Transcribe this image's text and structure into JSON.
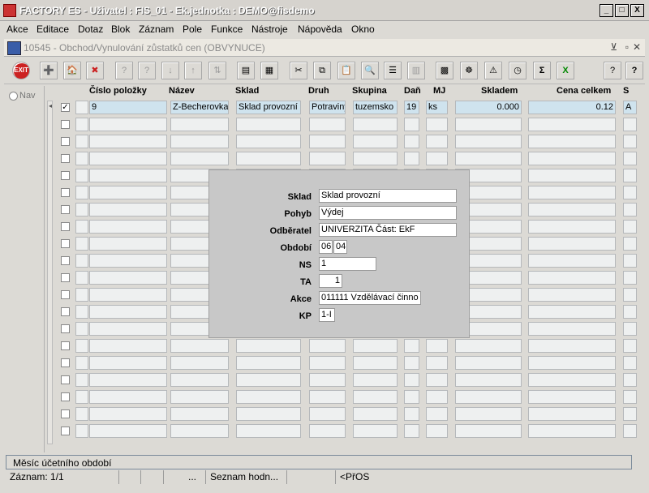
{
  "window": {
    "title": "FACTORY ES - Uživatel : FIS_01 - Ek.jednotka : DEMO@fisdemo",
    "btn_min": "_",
    "btn_max": "□",
    "btn_close": "X"
  },
  "menu": [
    "Akce",
    "Editace",
    "Dotaz",
    "Blok",
    "Záznam",
    "Pole",
    "Funkce",
    "Nástroje",
    "Nápověda",
    "Okno"
  ],
  "form": {
    "title": "10545 - Obchod/Vynulování zůstatků cen (OBVYNUCE)"
  },
  "toolbar": {
    "exit": "EXIT",
    "sum": "Σ"
  },
  "nav": {
    "label": "Nav"
  },
  "grid": {
    "headers": {
      "cislo": "Číslo položky",
      "nazev": "Název",
      "sklad": "Sklad",
      "druh": "Druh",
      "skupina": "Skupina",
      "dan": "Daň",
      "mj": "MJ",
      "skladem": "Skladem",
      "cena": "Cena celkem",
      "s": "S"
    },
    "row1": {
      "cislo": "9",
      "nazev": "Z-Becherovka",
      "sklad": "Sklad provozní",
      "druh": "Potraviny",
      "skupina": "tuzemsko",
      "dan": "19",
      "mj": "ks",
      "skladem": "0.000",
      "cena": "0.12",
      "s": "A",
      "checked": true
    }
  },
  "popup": {
    "sklad_label": "Sklad",
    "sklad_value": "Sklad provozní",
    "pohyb_label": "Pohyb",
    "pohyb_value": "Výdej",
    "odberatel_label": "Odběratel",
    "odberatel_value": "UNIVERZITA Část: EkF",
    "obdobi_label": "Období",
    "obdobi_month": "06",
    "obdobi_year": "04",
    "ns_label": "NS",
    "ns_value": "1",
    "ta_label": "TA",
    "ta_value": "1",
    "akce_label": "Akce",
    "akce_value": "011111 Vzdělávací činno",
    "kp_label": "KP",
    "kp_value": "1-I"
  },
  "status": {
    "hint": "Měsíc účetního období",
    "zaznam": "Záznam: 1/1",
    "ellipsis": "...",
    "seznam": "Seznam hodn...",
    "mode": "<PřOS"
  }
}
